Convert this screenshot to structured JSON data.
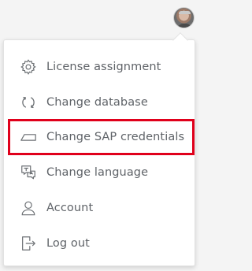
{
  "user": {
    "avatar_icon": "user-avatar"
  },
  "menu": {
    "items": [
      {
        "label": "License assignment",
        "icon": "gear-icon"
      },
      {
        "label": "Change database",
        "icon": "sync-icon"
      },
      {
        "label": "Change SAP credentials",
        "icon": "credentials-icon",
        "highlighted": true
      },
      {
        "label": "Change language",
        "icon": "language-icon"
      },
      {
        "label": "Account",
        "icon": "person-icon"
      },
      {
        "label": "Log out",
        "icon": "logout-icon"
      }
    ]
  },
  "colors": {
    "text": "#5f6368",
    "highlight": "#e0001b",
    "menu_bg": "#ffffff",
    "page_bg": "#f4f4f4"
  }
}
